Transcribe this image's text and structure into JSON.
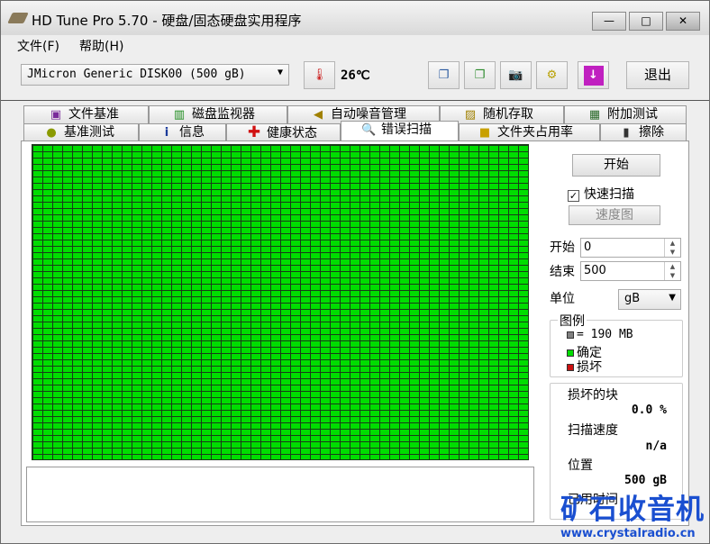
{
  "window": {
    "title": "HD Tune Pro 5.70 - 硬盘/固态硬盘实用程序",
    "min": "—",
    "max": "□",
    "close": "✕"
  },
  "menu": [
    "文件(F)",
    "帮助(H)"
  ],
  "toolbar": {
    "drive": "JMicron Generic DISK00 (500 gB)",
    "temperature": "26℃",
    "exit": "退出"
  },
  "tabs_top": [
    {
      "label": "文件基准",
      "icon": "file-benchmark-icon"
    },
    {
      "label": "磁盘监视器",
      "icon": "disk-monitor-icon"
    },
    {
      "label": "自动噪音管理",
      "icon": "speaker-icon"
    },
    {
      "label": "随机存取",
      "icon": "random-access-icon"
    },
    {
      "label": "附加测试",
      "icon": "extra-tests-icon"
    }
  ],
  "tabs_bottom": [
    {
      "label": "基准测试",
      "icon": "benchmark-icon"
    },
    {
      "label": "信息",
      "icon": "info-icon"
    },
    {
      "label": "健康状态",
      "icon": "health-icon"
    },
    {
      "label": "错误扫描",
      "icon": "magnifier-icon",
      "active": true
    },
    {
      "label": "文件夹占用率",
      "icon": "folder-icon"
    },
    {
      "label": "擦除",
      "icon": "trash-icon"
    }
  ],
  "scan": {
    "start_button": "开始",
    "quick_scan_label": "快速扫描",
    "quick_scan_checked": true,
    "speed_map_button": "速度图",
    "start_label": "开始",
    "start_value": "0",
    "end_label": "结束",
    "end_value": "500",
    "unit_label": "单位",
    "unit_value": "gB",
    "legend_title": "图例",
    "legend_block": "= 190 MB",
    "legend_ok": "确定",
    "legend_bad": "损坏",
    "damaged_label": "损坏的块",
    "damaged_value": "0.0 %",
    "speed_label": "扫描速度",
    "speed_value": "n/a",
    "position_label": "位置",
    "position_value": "500 gB",
    "elapsed_label": "已用时间"
  },
  "colors": {
    "ok": "#00dd00",
    "bad": "#cc1111",
    "block": "#808080"
  },
  "watermark": {
    "text": "矿石收音机",
    "url": "www.crystalradio.cn"
  }
}
